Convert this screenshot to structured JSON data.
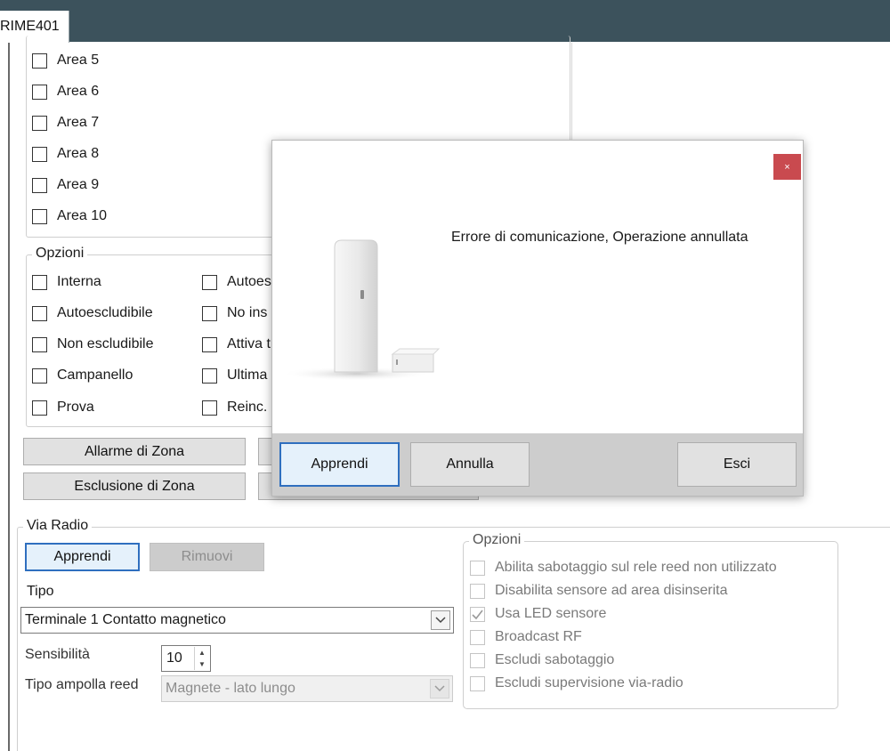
{
  "tab": {
    "title": "RIME401"
  },
  "areas": [
    "Area 5",
    "Area 6",
    "Area 7",
    "Area 8",
    "Area 9",
    "Area 10"
  ],
  "options": {
    "legend": "Opzioni",
    "col1": [
      "Interna",
      "Autoescludibile",
      "Non escludibile",
      "Campanello",
      "Prova"
    ],
    "col2": [
      "Autoes",
      "No ins",
      "Attiva t",
      "Ultima",
      "Reinc."
    ]
  },
  "zone_buttons": {
    "alarm": "Allarme di Zona",
    "exclusion": "Esclusione di Zona"
  },
  "radio": {
    "legend": "Via Radio",
    "learn": "Apprendi",
    "remove": "Rimuovi",
    "type_label": "Tipo",
    "type_value": "Terminale 1 Contatto magnetico",
    "sensitivity_label": "Sensibilità",
    "sensitivity_value": "10",
    "reed_label": "Tipo ampolla reed",
    "reed_value": "Magnete - lato lungo"
  },
  "radio_options": {
    "legend": "Opzioni",
    "items": [
      {
        "label": "Abilita sabotaggio sul rele reed non utilizzato",
        "checked": false
      },
      {
        "label": "Disabilita sensore ad area disinserita",
        "checked": false
      },
      {
        "label": "Usa LED sensore",
        "checked": true
      },
      {
        "label": "Broadcast RF",
        "checked": false
      },
      {
        "label": "Escludi sabotaggio",
        "checked": false
      },
      {
        "label": "Escludi supervisione via-radio",
        "checked": false
      }
    ]
  },
  "dialog": {
    "close": "×",
    "message": "Errore di comunicazione, Operazione annullata",
    "learn": "Apprendi",
    "cancel": "Annulla",
    "exit": "Esci"
  },
  "icons": {
    "close": "close-icon",
    "dropdown": "chevron-down-icon",
    "spin": "spinner-arrows-icon",
    "check": "check-icon"
  }
}
